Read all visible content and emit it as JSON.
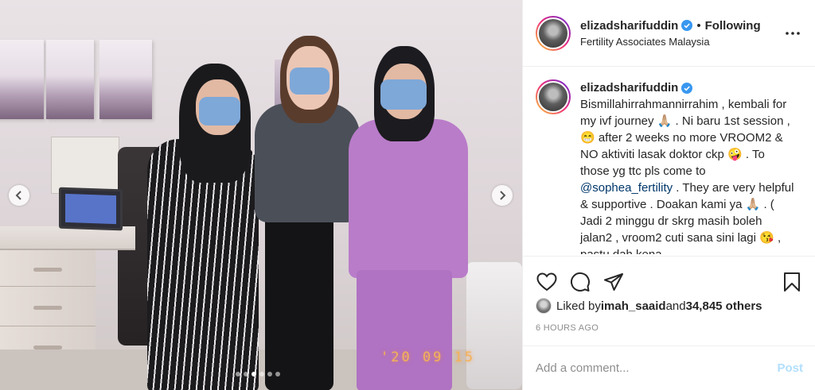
{
  "post": {
    "username": "elizadsharifuddin",
    "follow_separator": "•",
    "follow_status": "Following",
    "location": "Fertility Associates Malaysia",
    "more_icon": "more-horizontal-icon",
    "verified_icon": "verified-badge-icon"
  },
  "caption": {
    "username": "elizadsharifuddin",
    "text_part1": "Bismillahirrahmannirrahim , kembali for my ivf journey 🙏🏼 . Ni baru 1st session , 😁 after 2 weeks no more VROOM2 & NO aktiviti lasak doktor ckp 🤪 . To those yg ttc pls come to ",
    "mention": "@sophea_fertility",
    "text_part2": " . They are very helpful & supportive . Doakan kami ya 🙏🏼 . ( Jadi 2 minggu dr skrg masih boleh jalan2 , vroom2 cuti sana sini lagi 😘 , pastu dah kena"
  },
  "actions": {
    "like_icon": "heart-icon",
    "comment_icon": "comment-icon",
    "share_icon": "share-icon",
    "save_icon": "bookmark-icon"
  },
  "likes": {
    "prefix": "Liked by ",
    "user": "imah_saaid",
    "middle": " and ",
    "count": "34,845 others"
  },
  "timestamp": "6 HOURS AGO",
  "comment": {
    "placeholder": "Add a comment...",
    "post_label": "Post"
  },
  "photo": {
    "date_stamp": "'20 09 15",
    "carousel_dots": 6,
    "active_dot": 2,
    "prev_icon": "chevron-left-icon",
    "next_icon": "chevron-right-icon"
  },
  "colors": {
    "link": "#00376b",
    "post_disabled": "#b2dffc",
    "muted": "#8e8e8e",
    "text": "#262626"
  }
}
